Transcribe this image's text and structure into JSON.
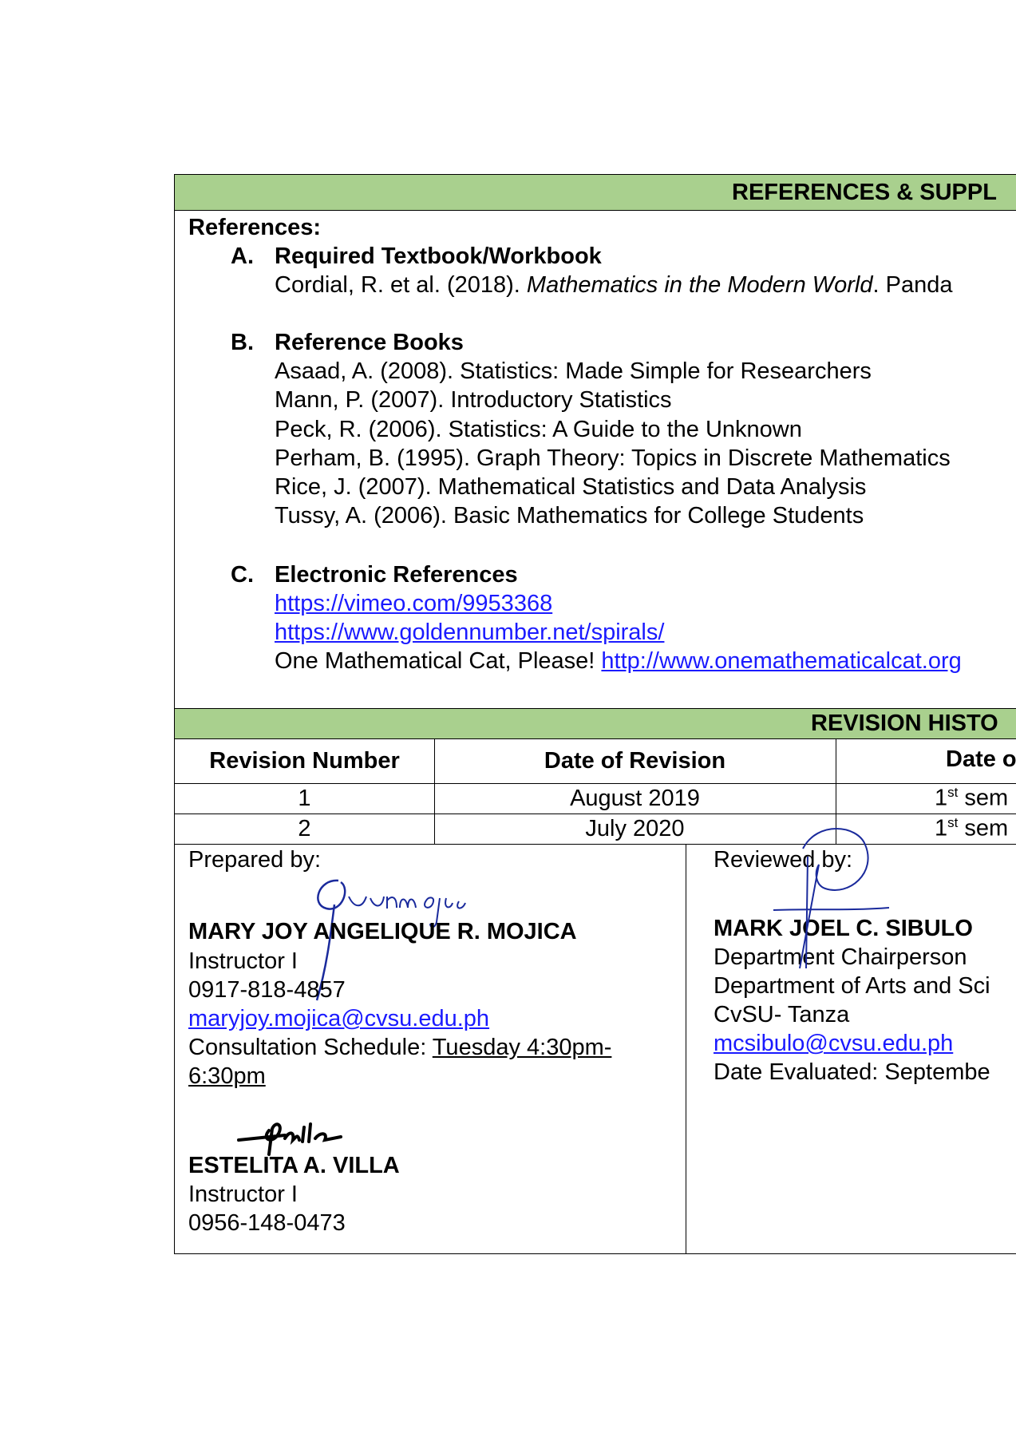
{
  "references_section": {
    "title": "REFERENCES & SUPPL",
    "heading": "References:",
    "a": {
      "letter": "A.",
      "title": "Required Textbook/Workbook",
      "entry_prefix": "Cordial, R. et al. (2018). ",
      "entry_italic": "Mathematics in the Modern World",
      "entry_suffix": ". Panda"
    },
    "b": {
      "letter": "B.",
      "title": "Reference Books",
      "items": [
        "Asaad, A. (2008). Statistics: Made Simple for Researchers",
        "Mann, P. (2007). Introductory Statistics",
        "Peck, R. (2006). Statistics: A Guide to the Unknown",
        "Perham, B. (1995). Graph Theory: Topics in Discrete Mathematics",
        "Rice, J. (2007). Mathematical Statistics and Data Analysis",
        "Tussy, A. (2006). Basic Mathematics for College Students"
      ]
    },
    "c": {
      "letter": "C.",
      "title": "Electronic References",
      "link1": "https://vimeo.com/9953368",
      "link2": "https://www.goldennumber.net/spirals/",
      "text3": "One Mathematical Cat, Please! ",
      "link3": "http://www.onemathematicalcat.org"
    }
  },
  "revision_history": {
    "title": "REVISION HISTO",
    "headers": [
      "Revision Number",
      "Date of Revision",
      "Date o"
    ],
    "rows": [
      {
        "number": "1",
        "date": "August 2019",
        "effect_num": "1",
        "effect_sup": "st",
        "effect_text": " sem"
      },
      {
        "number": "2",
        "date": "July 2020",
        "effect_num": "1",
        "effect_sup": "st",
        "effect_text": " sem"
      }
    ]
  },
  "prepared": {
    "label": "Prepared by:",
    "person1": {
      "name": "MARY JOY ANGELIQUE R. MOJICA",
      "position": "Instructor I",
      "phone": "0917-818-4857",
      "email": "maryjoy.mojica@cvsu.edu.ph",
      "consult_label": "Consultation Schedule: ",
      "consult_value1": "Tuesday 4:30pm-",
      "consult_value2": "6:30pm",
      "signature_text": "Mjarm ojica"
    },
    "person2": {
      "name": "ESTELITA A. VILLA",
      "position": "Instructor I",
      "phone": "0956-148-0473",
      "signature_text": "Villa"
    }
  },
  "reviewed": {
    "label": "Reviewed by:",
    "name": "MARK JOEL C. SIBULO",
    "position": "Department Chairperson",
    "department": "Department of Arts and Sci",
    "campus": "CvSU- Tanza",
    "email": "mcsibulo@cvsu.edu.ph",
    "date_evaluated": "Date Evaluated: Septembe"
  },
  "colors": {
    "band": "#a9d08e",
    "link": "#1a1aff",
    "signature_ink": "#1a2a9c"
  }
}
